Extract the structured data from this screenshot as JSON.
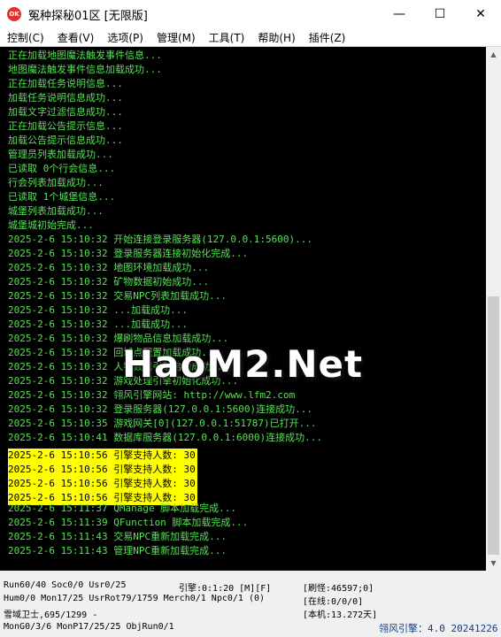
{
  "window": {
    "icon_text": "OK",
    "title": "冤种探秘01区 [无限版]",
    "minimize": "—",
    "maximize": "☐",
    "close": "✕"
  },
  "menu": [
    "控制(C)",
    "查看(V)",
    "选项(P)",
    "管理(M)",
    "工具(T)",
    "帮助(H)",
    "插件(Z)"
  ],
  "console": {
    "lines": [
      {
        "text": "正在加载地图魔法触发事件信息..."
      },
      {
        "text": "地图魔法触发事件信息加载成功..."
      },
      {
        "text": "正在加载任务说明信息..."
      },
      {
        "text": "加载任务说明信息成功..."
      },
      {
        "text": "加载文字过滤信息成功..."
      },
      {
        "text": "正在加载公告提示信息..."
      },
      {
        "text": "加载公告提示信息成功..."
      },
      {
        "text": "管理员列表加载成功..."
      },
      {
        "text": "已读取 0个行会信息..."
      },
      {
        "text": "行会列表加载成功..."
      },
      {
        "text": "已读取 1个城堡信息..."
      },
      {
        "text": "城堡列表加载成功..."
      },
      {
        "text": "城堡城初始完成..."
      },
      {
        "text": "2025-2-6 15:10:32 开始连接登录服务器(127.0.0.1:5600)..."
      },
      {
        "text": "2025-2-6 15:10:32 登录服务器连接初始化完成..."
      },
      {
        "text": "2025-2-6 15:10:32 地图环境加载成功..."
      },
      {
        "text": "2025-2-6 15:10:32 矿物数据初始成功..."
      },
      {
        "text": "2025-2-6 15:10:32 交易NPC列表加载成功..."
      },
      {
        "text": "2025-2-6 15:10:32 ...加载成功..."
      },
      {
        "text": "2025-2-6 15:10:32 ...加载成功..."
      },
      {
        "text": "2025-2-6 15:10:32 爆刷物品信息加载成功..."
      },
      {
        "text": "2025-2-6 15:10:32 回城点配置加载成功..."
      },
      {
        "text": "2025-2-6 15:10:32 人物数据引擎启动成功..."
      },
      {
        "text": "2025-2-6 15:10:32 游戏处理引擎初始化成功..."
      },
      {
        "text": "2025-2-6 15:10:32 翎风引擎网站: http://www.lfm2.com"
      },
      {
        "text": "2025-2-6 15:10:32 登录服务器(127.0.0.1:5600)连接成功..."
      },
      {
        "text": "2025-2-6 15:10:35 游戏网关[0](127.0.0.1:51787)已打开..."
      },
      {
        "text": "2025-2-6 15:10:41 数据库服务器(127.0.0.1:6000)连接成功..."
      },
      {
        "text": "2025-2-6 15:10:56 引擎支持人数: 30",
        "highlight": true
      },
      {
        "text": "2025-2-6 15:10:56 引擎支持人数: 30",
        "highlight": true
      },
      {
        "text": "2025-2-6 15:10:56 引擎支持人数: 30",
        "highlight": true
      },
      {
        "text": "2025-2-6 15:10:56 引擎支持人数: 30",
        "highlight": true
      },
      {
        "text": "2025-2-6 15:11:37 QManage 脚本加载完成..."
      },
      {
        "text": "2025-2-6 15:11:39 QFunction 脚本加载完成..."
      },
      {
        "text": "2025-2-6 15:11:43 交易NPC重新加载完成..."
      },
      {
        "text": "2025-2-6 15:11:43 管理NPC重新加载完成..."
      }
    ]
  },
  "watermark": "HaoM2.Net",
  "status": {
    "row1_left": "Run60/40 Soc0/0 Usr0/25",
    "row1_mid": "引擎:0:1:20 [M][F]",
    "row1_right": "[刷怪:46597;0]",
    "row2_left": "Hum0/0 Mon17/25 UsrRot79/1759 Merch0/1 Npc0/1 (0)",
    "row2_right": "[在线:0/0/0]",
    "row3_left": "雪域卫士,695/1299 -",
    "row3_right": "[本机:13.272天]",
    "row4_left": "MonG0/3/6 MonP17/25/25 ObjRun0/1",
    "row4_right": "翎风引擎：4.0 20241226"
  },
  "colors": {
    "console_bg": "#000000",
    "console_text": "#56e356",
    "highlight_bg": "#ffff00",
    "version_text": "#0b3c9e"
  }
}
